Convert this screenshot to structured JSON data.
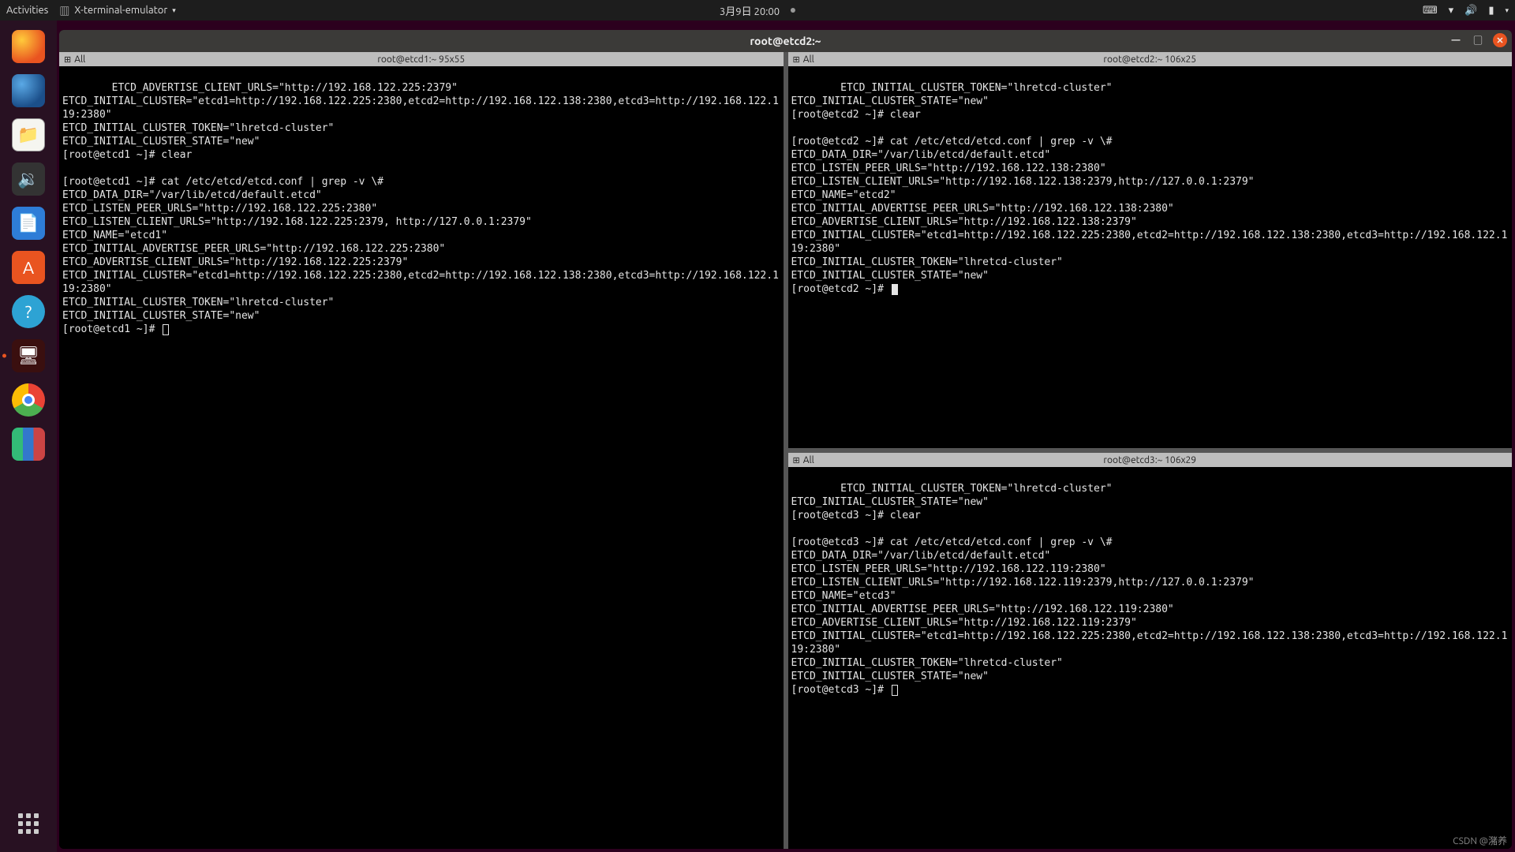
{
  "topbar": {
    "activities": "Activities",
    "app_name": "X-terminal-emulator",
    "clock": "3月9日  20:00"
  },
  "dock": [
    {
      "name": "firefox",
      "label": "Firefox"
    },
    {
      "name": "thunderbird",
      "label": "Thunderbird"
    },
    {
      "name": "files",
      "label": "Files"
    },
    {
      "name": "rhythmbox",
      "label": "Rhythmbox"
    },
    {
      "name": "writer",
      "label": "LibreOffice Writer"
    },
    {
      "name": "software",
      "label": "Ubuntu Software"
    },
    {
      "name": "help",
      "label": "Help"
    },
    {
      "name": "terminator",
      "label": "Terminator",
      "active": true
    },
    {
      "name": "chrome",
      "label": "Google Chrome"
    },
    {
      "name": "vmm",
      "label": "Virtual Machine Manager"
    }
  ],
  "window": {
    "title": "root@etcd2:~"
  },
  "panes": {
    "left": {
      "tag": "All",
      "size_label": "root@etcd1:~ 95x55",
      "lines": [
        "ETCD_ADVERTISE_CLIENT_URLS=\"http://192.168.122.225:2379\"",
        "ETCD_INITIAL_CLUSTER=\"etcd1=http://192.168.122.225:2380,etcd2=http://192.168.122.138:2380,etcd3=http://192.168.122.119:2380\"",
        "ETCD_INITIAL_CLUSTER_TOKEN=\"lhretcd-cluster\"",
        "ETCD_INITIAL_CLUSTER_STATE=\"new\"",
        "[root@etcd1 ~]# clear",
        "",
        "[root@etcd1 ~]# cat /etc/etcd/etcd.conf | grep -v \\#",
        "ETCD_DATA_DIR=\"/var/lib/etcd/default.etcd\"",
        "ETCD_LISTEN_PEER_URLS=\"http://192.168.122.225:2380\"",
        "ETCD_LISTEN_CLIENT_URLS=\"http://192.168.122.225:2379, http://127.0.0.1:2379\"",
        "ETCD_NAME=\"etcd1\"",
        "ETCD_INITIAL_ADVERTISE_PEER_URLS=\"http://192.168.122.225:2380\"",
        "ETCD_ADVERTISE_CLIENT_URLS=\"http://192.168.122.225:2379\"",
        "ETCD_INITIAL_CLUSTER=\"etcd1=http://192.168.122.225:2380,etcd2=http://192.168.122.138:2380,etcd3=http://192.168.122.119:2380\"",
        "ETCD_INITIAL_CLUSTER_TOKEN=\"lhretcd-cluster\"",
        "ETCD_INITIAL_CLUSTER_STATE=\"new\"",
        "[root@etcd1 ~]# "
      ]
    },
    "topright": {
      "tag": "All",
      "size_label": "root@etcd2:~ 106x25",
      "lines": [
        "ETCD_INITIAL_CLUSTER_TOKEN=\"lhretcd-cluster\"",
        "ETCD_INITIAL_CLUSTER_STATE=\"new\"",
        "[root@etcd2 ~]# clear",
        "",
        "[root@etcd2 ~]# cat /etc/etcd/etcd.conf | grep -v \\#",
        "ETCD_DATA_DIR=\"/var/lib/etcd/default.etcd\"",
        "ETCD_LISTEN_PEER_URLS=\"http://192.168.122.138:2380\"",
        "ETCD_LISTEN_CLIENT_URLS=\"http://192.168.122.138:2379,http://127.0.0.1:2379\"",
        "ETCD_NAME=\"etcd2\"",
        "ETCD_INITIAL_ADVERTISE_PEER_URLS=\"http://192.168.122.138:2380\"",
        "ETCD_ADVERTISE_CLIENT_URLS=\"http://192.168.122.138:2379\"",
        "ETCD_INITIAL_CLUSTER=\"etcd1=http://192.168.122.225:2380,etcd2=http://192.168.122.138:2380,etcd3=http://192.168.122.119:2380\"",
        "ETCD_INITIAL_CLUSTER_TOKEN=\"lhretcd-cluster\"",
        "ETCD_INITIAL_CLUSTER_STATE=\"new\"",
        "[root@etcd2 ~]# "
      ]
    },
    "bottomright": {
      "tag": "All",
      "size_label": "root@etcd3:~ 106x29",
      "lines": [
        "ETCD_INITIAL_CLUSTER_TOKEN=\"lhretcd-cluster\"",
        "ETCD_INITIAL_CLUSTER_STATE=\"new\"",
        "[root@etcd3 ~]# clear",
        "",
        "[root@etcd3 ~]# cat /etc/etcd/etcd.conf | grep -v \\#",
        "ETCD_DATA_DIR=\"/var/lib/etcd/default.etcd\"",
        "ETCD_LISTEN_PEER_URLS=\"http://192.168.122.119:2380\"",
        "ETCD_LISTEN_CLIENT_URLS=\"http://192.168.122.119:2379,http://127.0.0.1:2379\"",
        "ETCD_NAME=\"etcd3\"",
        "ETCD_INITIAL_ADVERTISE_PEER_URLS=\"http://192.168.122.119:2380\"",
        "ETCD_ADVERTISE_CLIENT_URLS=\"http://192.168.122.119:2379\"",
        "ETCD_INITIAL_CLUSTER=\"etcd1=http://192.168.122.225:2380,etcd2=http://192.168.122.138:2380,etcd3=http://192.168.122.119:2380\"",
        "ETCD_INITIAL_CLUSTER_TOKEN=\"lhretcd-cluster\"",
        "ETCD_INITIAL_CLUSTER_STATE=\"new\"",
        "[root@etcd3 ~]# "
      ]
    }
  },
  "watermark": "CSDN @潴养"
}
